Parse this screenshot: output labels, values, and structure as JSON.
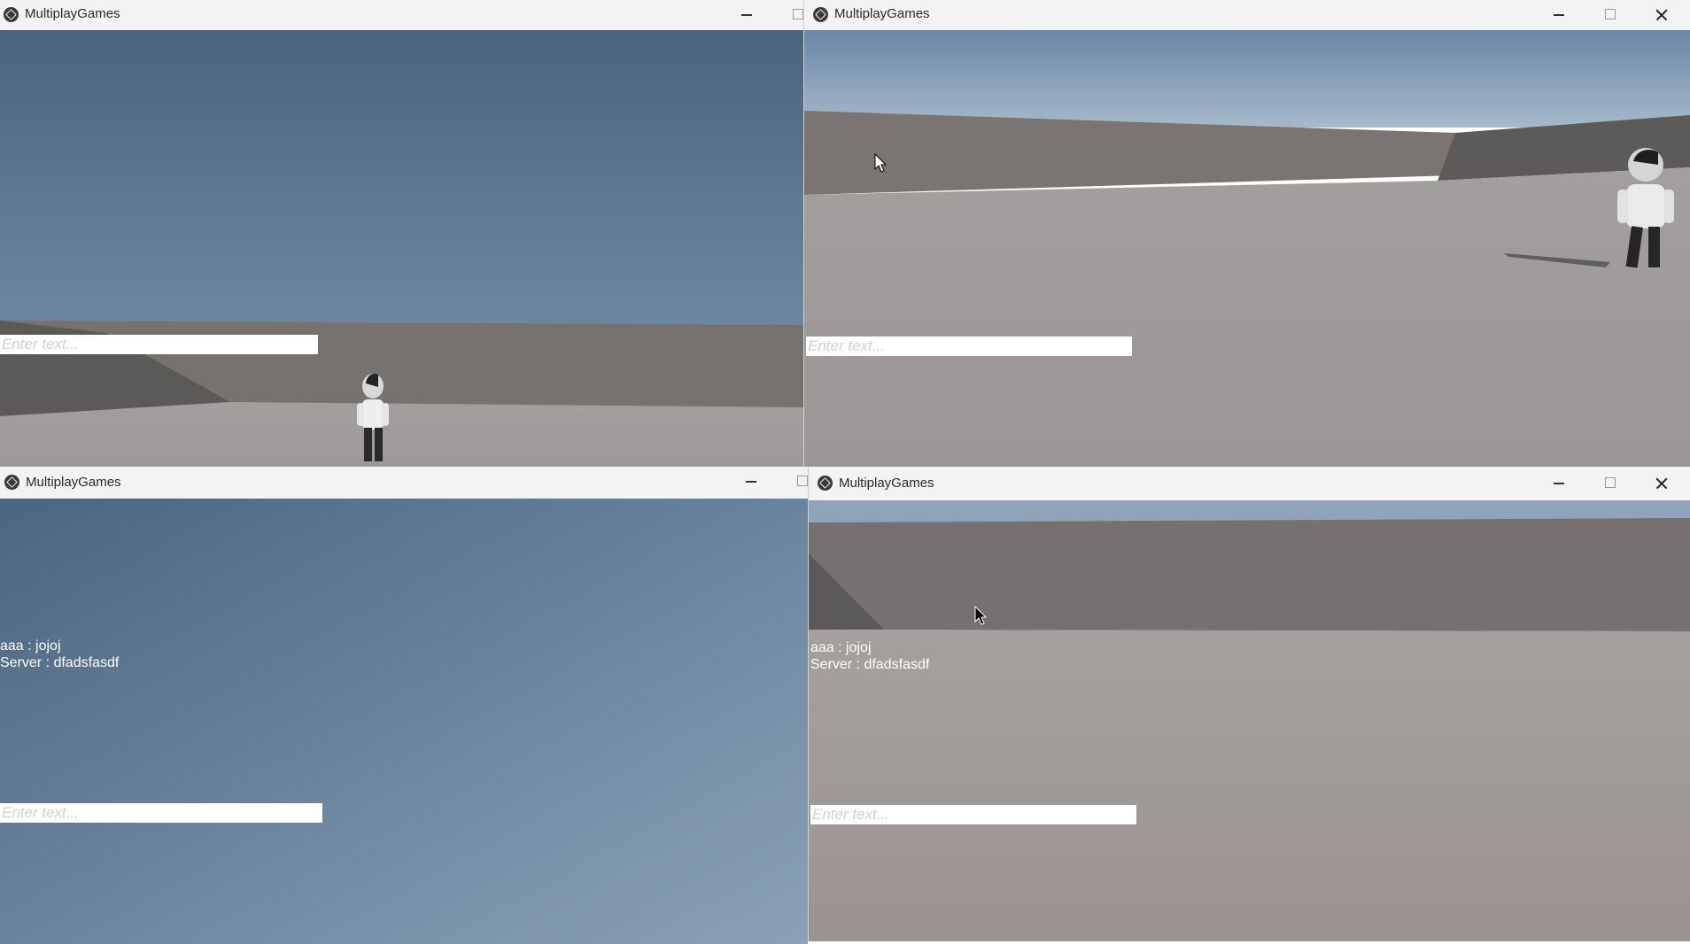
{
  "windows": {
    "top_left": {
      "title": "MultiplayGames",
      "input_placeholder": "Enter text..."
    },
    "top_right": {
      "title": "MultiplayGames",
      "input_placeholder": "Enter text..."
    },
    "bottom_left": {
      "title": "MultiplayGames",
      "input_placeholder": "Enter text...",
      "chat": [
        {
          "text": "aaa : jojoj"
        },
        {
          "text": "Server : dfadsfasdf"
        }
      ]
    },
    "bottom_right": {
      "title": "MultiplayGames",
      "input_placeholder": "Enter text...",
      "chat": [
        {
          "text": "aaa : jojoj"
        },
        {
          "text": "Server : dfadsfasdf"
        }
      ]
    }
  },
  "icons": [
    "unity-app-icon",
    "minimize-icon",
    "maximize-icon",
    "close-icon",
    "mouse-cursor-icon"
  ],
  "colors": {
    "titlebar": "#f3f3f3",
    "sky_top": "#4b6480",
    "sky_bottom": "#8aa0b7",
    "wall": "#777270",
    "ground": "#a39e9e",
    "chat_text": "#ffffff",
    "input_bg": "#ffffff"
  }
}
